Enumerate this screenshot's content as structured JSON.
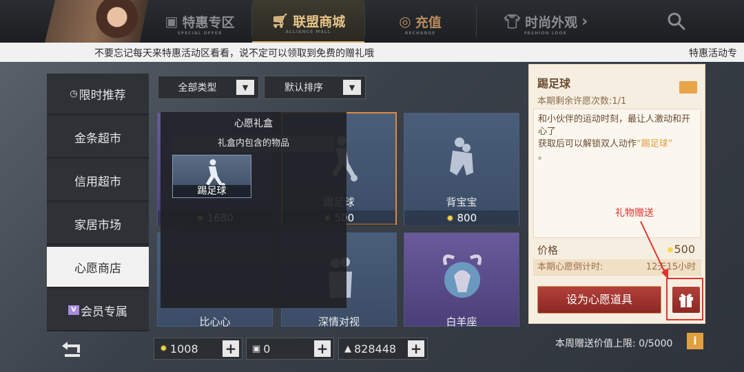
{
  "tabs": [
    {
      "label": "特惠专区",
      "sub": "SPECIAL OFFER",
      "icon": "gift-bag-icon"
    },
    {
      "label": "联盟商城",
      "sub": "ALLIANCE MALL",
      "icon": "shopping-cart-icon"
    },
    {
      "label": "充值",
      "sub": "RECHARGE",
      "icon": "coin-icon"
    },
    {
      "label": "时尚外观",
      "sub": "FASHION LOOK",
      "icon": "shirt-icon",
      "arrow": "›"
    }
  ],
  "announcement": {
    "text": "不要忘记每天来特惠活动区看看，说不定可以领取到免费的赠礼哦",
    "right_text": "特惠活动专"
  },
  "sidebar": {
    "items": [
      {
        "label": "限时推荐",
        "icon": "clock-icon"
      },
      {
        "label": "金条超市"
      },
      {
        "label": "信用超市"
      },
      {
        "label": "家居市场"
      },
      {
        "label": "心愿商店",
        "active": true
      },
      {
        "label": "会员专属",
        "icon": "vip-icon",
        "badge": "V"
      }
    ]
  },
  "filters": {
    "type_label": "全部类型",
    "sort_label": "默认排序"
  },
  "cards": [
    {
      "name": "",
      "price": "1680"
    },
    {
      "name": "踢足球",
      "price": "500"
    },
    {
      "name": "背宝宝",
      "price": "800"
    },
    {
      "name": "比心心",
      "price": ""
    },
    {
      "name": "深情对视",
      "price": ""
    },
    {
      "name": "白羊座",
      "price": ""
    }
  ],
  "popup": {
    "title": "心愿礼盒",
    "subtitle": "礼盒内包含的物品",
    "item_label": "踢足球"
  },
  "detail": {
    "title": "踢足球",
    "wish_count": "本期剩余许愿次数:1/1",
    "desc_line1": "和小伙伴的运动时刻，最让人激动和开心了",
    "desc_line2": "获取后可以解锁双人动作",
    "desc_highlight": "“踢足球”",
    "desc_tail": "。",
    "price_label": "价格",
    "price": "500",
    "countdown_label": "本期心愿倒计时:",
    "countdown_value": "12天15小时",
    "wish_button": "设为心愿道具",
    "gift_annotation": "礼物赠送"
  },
  "weekly_limit": "本周赠送价值上限: 0/5000",
  "info_label": "i",
  "currencies": [
    {
      "name": "gold",
      "value": "1008",
      "icon": "gold-coin-icon"
    },
    {
      "name": "ticket",
      "value": "0",
      "icon": "ticket-icon"
    },
    {
      "name": "coin",
      "value": "828448",
      "icon": "alliance-coin-icon"
    }
  ],
  "colors": {
    "accent_gold": "#e8c58a",
    "wish_button": "#a8352f",
    "annotation_red": "#e4312d"
  }
}
